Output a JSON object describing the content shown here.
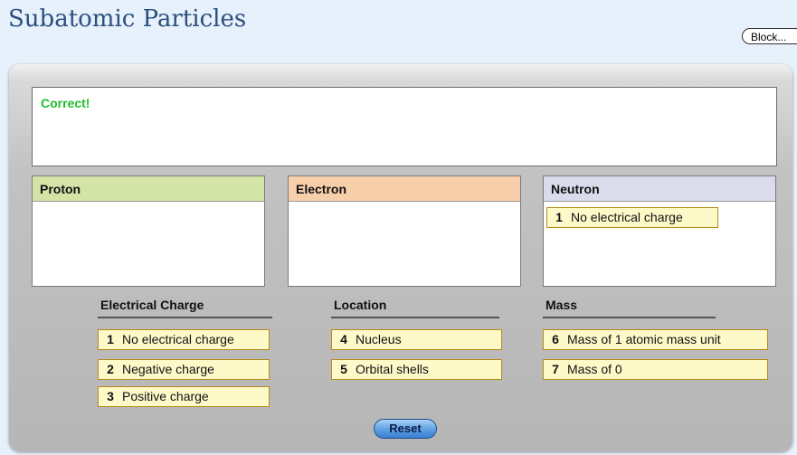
{
  "page": {
    "title": "Subatomic Particles",
    "block_label": "Block..."
  },
  "feedback": {
    "text": "Correct!",
    "color": "#1fbf2a"
  },
  "drop_boxes": [
    {
      "label": "Proton",
      "header_color": "#d3e4a6",
      "items": []
    },
    {
      "label": "Electron",
      "header_color": "#f8cfab",
      "items": []
    },
    {
      "label": "Neutron",
      "header_color": "#dadceb",
      "items": [
        {
          "num": "1",
          "text": "No electrical charge"
        }
      ]
    }
  ],
  "categories": [
    {
      "heading": "Electrical Charge",
      "items": [
        {
          "num": "1",
          "text": "No electrical charge"
        },
        {
          "num": "2",
          "text": "Negative charge"
        },
        {
          "num": "3",
          "text": "Positive charge"
        }
      ]
    },
    {
      "heading": "Location",
      "items": [
        {
          "num": "4",
          "text": "Nucleus"
        },
        {
          "num": "5",
          "text": "Orbital shells"
        }
      ]
    },
    {
      "heading": "Mass",
      "items": [
        {
          "num": "6",
          "text": "Mass of 1 atomic mass unit"
        },
        {
          "num": "7",
          "text": "Mass of 0"
        }
      ]
    }
  ],
  "buttons": {
    "reset_label": "Reset"
  },
  "colors": {
    "tile_bg": "#fef9c9",
    "tile_border": "#b58b1a",
    "title": "#2b4f7c"
  }
}
